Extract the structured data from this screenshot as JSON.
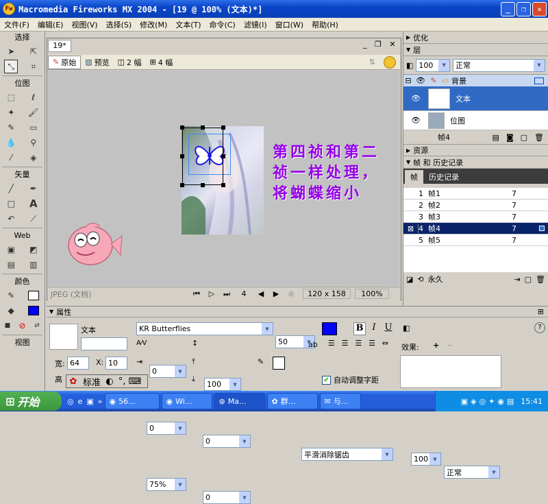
{
  "window": {
    "title": "Macromedia Fireworks MX 2004 - [19 @ 100% (文本)*]"
  },
  "menu": [
    "文件(F)",
    "编辑(E)",
    "视图(V)",
    "选择(S)",
    "修改(M)",
    "文本(T)",
    "命令(C)",
    "滤镜(I)",
    "窗口(W)",
    "帮助(H)"
  ],
  "toolbox": {
    "sections": [
      "选择",
      "位图",
      "矢量",
      "Web",
      "颜色",
      "视图"
    ],
    "fill_color": "#0000ff",
    "stroke_color": "#000000"
  },
  "document": {
    "tab": "19*",
    "views": {
      "original": "原始",
      "preview": "预览",
      "two_up": "2 幅",
      "four_up": "4 幅"
    },
    "note_text": "第四祯和第二祯一样处理，将蝴蝶缩小",
    "note_color": "#9400e8",
    "status": {
      "format": "JPEG (文档)",
      "frame": "4",
      "size": "120 x 158",
      "zoom": "100%"
    }
  },
  "panels": {
    "optimize": "优化",
    "layers": {
      "title": "层",
      "opacity": "100",
      "blend": "正常",
      "folder": "背景",
      "items": [
        {
          "name": "文本"
        },
        {
          "name": "位图"
        }
      ],
      "frame_label": "帧4"
    },
    "assets": "资源",
    "frames_history": {
      "title": "帧 和 历史记录",
      "tabs": [
        "帧",
        "历史记录"
      ],
      "frames": [
        {
          "num": "1",
          "name": "帧1",
          "delay": "7"
        },
        {
          "num": "2",
          "name": "帧2",
          "delay": "7"
        },
        {
          "num": "3",
          "name": "帧3",
          "delay": "7"
        },
        {
          "num": "4",
          "name": "帧4",
          "delay": "7"
        },
        {
          "num": "5",
          "name": "帧5",
          "delay": "7"
        }
      ],
      "loop": "永久"
    }
  },
  "properties": {
    "title": "属性",
    "object_type": "文本",
    "font": "KR Butterflies",
    "size": "50",
    "text_color": "#0000ff",
    "bold": "B",
    "italic": "I",
    "underline": "U",
    "kerning": "0",
    "leading": "100",
    "leading_unit": "%",
    "width_label": "宽:",
    "width": "64",
    "x_label": "X:",
    "x": "10",
    "height_label": "高",
    "indent": "0",
    "space_before": "0",
    "space_after": "0",
    "baseline": "0",
    "scale": "75%",
    "antialias": "平滑消除锯齿",
    "auto_kern": "自动调整字距",
    "opacity": "100",
    "blend": "正常",
    "effects_label": "效果:"
  },
  "ime": {
    "label": "标准"
  },
  "taskbar": {
    "start": "开始",
    "tasks": [
      "56...",
      "Wi...",
      "Ma...",
      "群...",
      "与..."
    ],
    "clock": "15:41"
  }
}
